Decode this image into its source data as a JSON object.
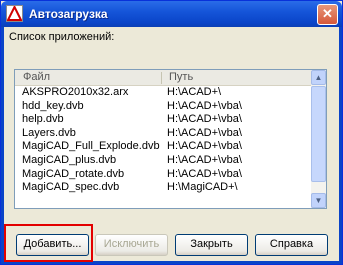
{
  "window": {
    "title": "Автозагрузка",
    "close_label": "✕"
  },
  "list": {
    "label": "Список приложений:",
    "headers": {
      "file": "Файл",
      "path": "Путь"
    },
    "rows": [
      {
        "file": "AKSPRO2010x32.arx",
        "path": "H:\\ACAD+\\"
      },
      {
        "file": "hdd_key.dvb",
        "path": "H:\\ACAD+\\vba\\"
      },
      {
        "file": "help.dvb",
        "path": "H:\\ACAD+\\vba\\"
      },
      {
        "file": "Layers.dvb",
        "path": "H:\\ACAD+\\vba\\"
      },
      {
        "file": "MagiCAD_Full_Explode.dvb",
        "path": "H:\\ACAD+\\vba\\"
      },
      {
        "file": "MagiCAD_plus.dvb",
        "path": "H:\\ACAD+\\vba\\"
      },
      {
        "file": "MagiCAD_rotate.dvb",
        "path": "H:\\ACAD+\\vba\\"
      },
      {
        "file": "MagiCAD_spec.dvb",
        "path": "H:\\MagiCAD+\\"
      }
    ]
  },
  "buttons": {
    "add": "Добавить...",
    "exclude": "Исключить",
    "close": "Закрыть",
    "help": "Справка"
  },
  "colors": {
    "titlebar": "#0A44C8",
    "highlight": "#E30000",
    "dialog_bg": "#ECE9D8"
  },
  "icons": {
    "app": "autocad-icon",
    "close": "close-icon"
  }
}
